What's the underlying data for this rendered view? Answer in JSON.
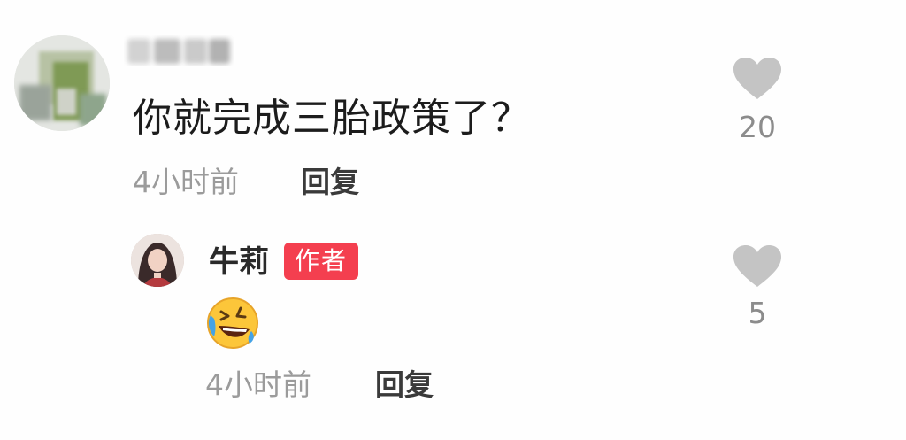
{
  "comment": {
    "text": "你就完成三胎政策了？",
    "time": "4小时前",
    "reply_label": "回复",
    "likes": "20"
  },
  "reply": {
    "username": "牛莉",
    "badge": "作者",
    "emoji": "rolling-on-floor-laughing",
    "time": "4小时前",
    "reply_label": "回复",
    "likes": "5"
  },
  "colors": {
    "badge_bg": "#f43f4f",
    "heart": "#c4c4c4",
    "time_text": "#9b9b9b"
  }
}
